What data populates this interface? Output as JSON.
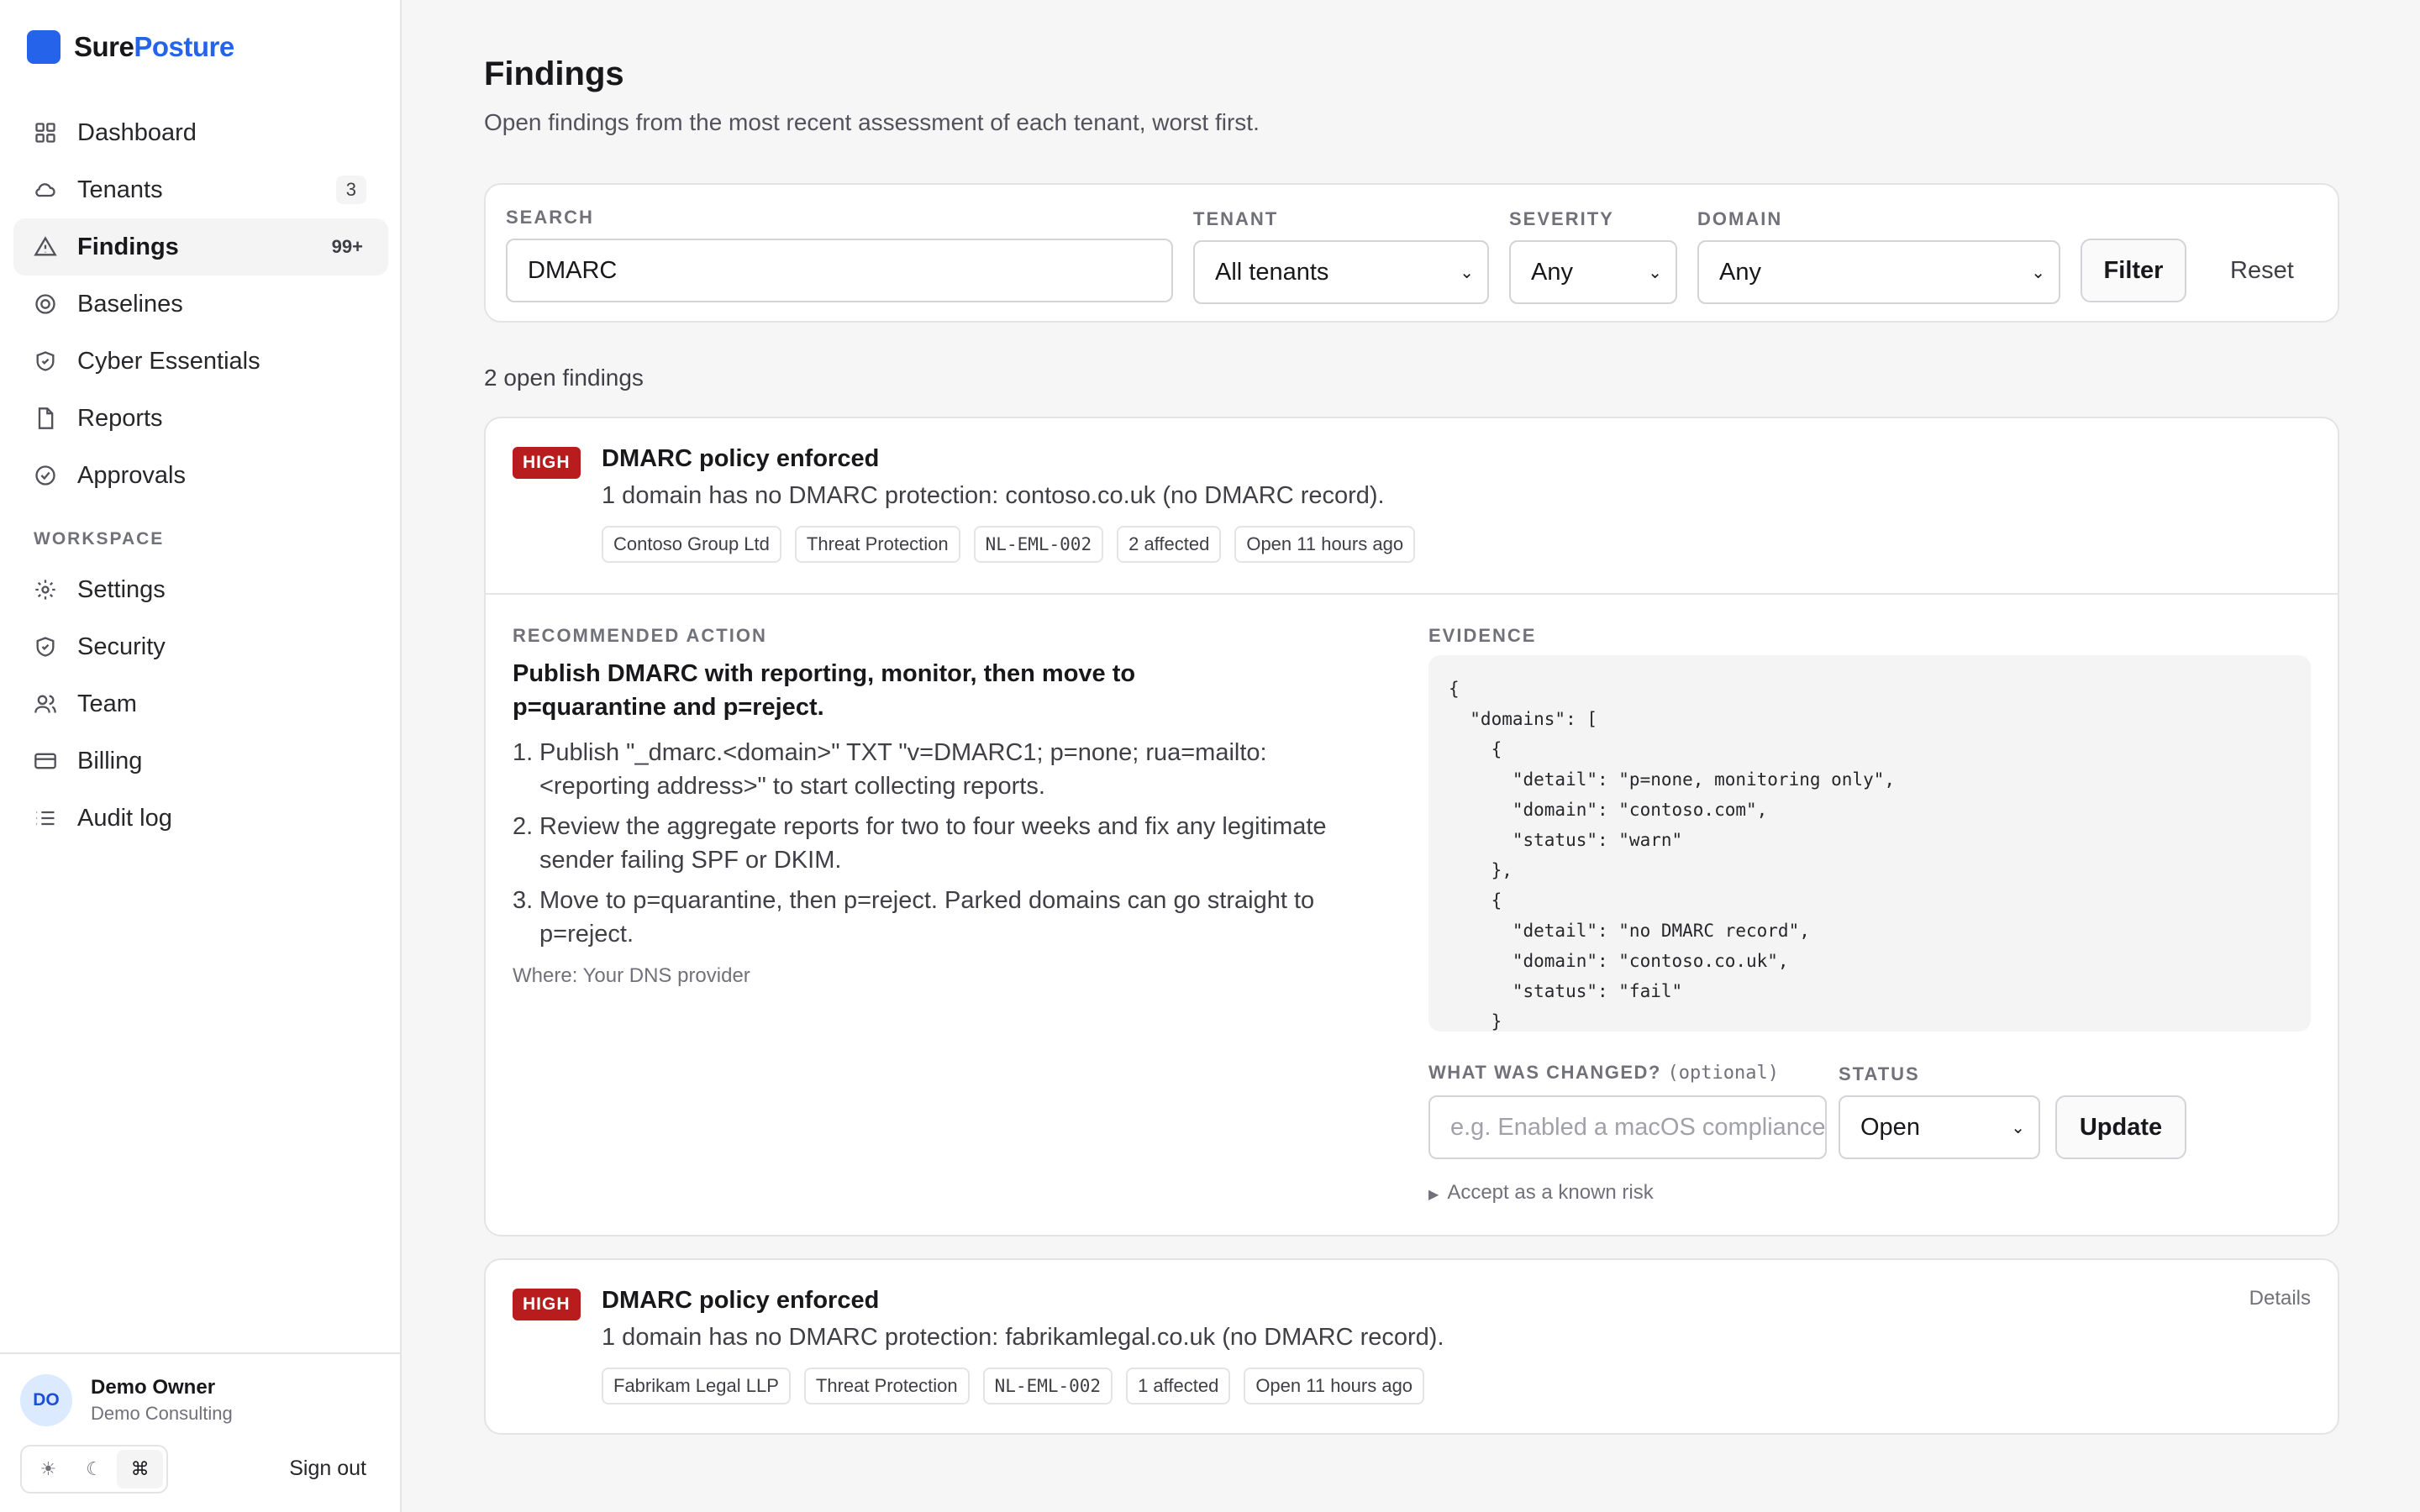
{
  "brand": {
    "name_part1": "Sure",
    "name_part2": "Posture"
  },
  "nav": {
    "items": [
      {
        "label": "Dashboard",
        "icon": "grid-icon"
      },
      {
        "label": "Tenants",
        "icon": "cloud-icon",
        "badge": "3"
      },
      {
        "label": "Findings",
        "icon": "alert-triangle-icon",
        "badge": "99+",
        "active": true
      },
      {
        "label": "Baselines",
        "icon": "target-icon"
      },
      {
        "label": "Cyber Essentials",
        "icon": "shield-check-icon"
      },
      {
        "label": "Reports",
        "icon": "file-icon"
      },
      {
        "label": "Approvals",
        "icon": "check-circle-icon"
      }
    ],
    "section_label": "WORKSPACE",
    "workspace_items": [
      {
        "label": "Settings",
        "icon": "gear-icon"
      },
      {
        "label": "Security",
        "icon": "shield-icon"
      },
      {
        "label": "Team",
        "icon": "users-icon"
      },
      {
        "label": "Billing",
        "icon": "credit-card-icon"
      },
      {
        "label": "Audit log",
        "icon": "list-icon"
      }
    ]
  },
  "user": {
    "initials": "DO",
    "name": "Demo Owner",
    "org": "Demo Consulting",
    "sign_out": "Sign out"
  },
  "theme_toggle": {
    "light": "☀",
    "dark": "☾",
    "system": "⌘"
  },
  "page": {
    "title": "Findings",
    "subtitle": "Open findings from the most recent assessment of each tenant, worst first."
  },
  "filters": {
    "search_label": "SEARCH",
    "search_value": "DMARC",
    "tenant_label": "TENANT",
    "tenant_value": "All tenants",
    "severity_label": "SEVERITY",
    "severity_value": "Any",
    "domain_label": "DOMAIN",
    "domain_value": "Any",
    "filter_button": "Filter",
    "reset_button": "Reset"
  },
  "results_count": "2 open findings",
  "findings": [
    {
      "severity": "HIGH",
      "title": "DMARC policy enforced",
      "description": "1 domain has no DMARC protection: contoso.co.uk (no DMARC record).",
      "chips": [
        "Contoso Group Ltd",
        "Threat Protection",
        "NL-EML-002",
        "2 affected",
        "Open 11 hours ago"
      ],
      "recommended_label": "RECOMMENDED ACTION",
      "recommended_title": "Publish DMARC with reporting, monitor, then move to p=quarantine and p=reject.",
      "steps": [
        "Publish \"_dmarc.<domain>\" TXT \"v=DMARC1; p=none; rua=mailto:<reporting address>\" to start collecting reports.",
        "Review the aggregate reports for two to four weeks and fix any legitimate sender failing SPF or DKIM.",
        "Move to p=quarantine, then p=reject. Parked domains can go straight to p=reject."
      ],
      "where": "Where: Your DNS provider",
      "evidence_label": "EVIDENCE",
      "evidence": "{\n  \"domains\": [\n    {\n      \"detail\": \"p=none, monitoring only\",\n      \"domain\": \"contoso.com\",\n      \"status\": \"warn\"\n    },\n    {\n      \"detail\": \"no DMARC record\",\n      \"domain\": \"contoso.co.uk\",\n      \"status\": \"fail\"\n    }",
      "changed_label": "WHAT WAS CHANGED?",
      "changed_optional": "(optional)",
      "changed_placeholder": "e.g. Enabled a macOS compliance policy",
      "status_label": "STATUS",
      "status_value": "Open",
      "update_button": "Update",
      "accept_risk": "Accept as a known risk"
    },
    {
      "severity": "HIGH",
      "title": "DMARC policy enforced",
      "description": "1 domain has no DMARC protection: fabrikamlegal.co.uk (no DMARC record).",
      "chips": [
        "Fabrikam Legal LLP",
        "Threat Protection",
        "NL-EML-002",
        "1 affected",
        "Open 11 hours ago"
      ],
      "details_link": "Details"
    }
  ],
  "colors": {
    "accent": "#2563eb",
    "high_severity": "#b91c1c",
    "background": "#f6f6f6"
  }
}
